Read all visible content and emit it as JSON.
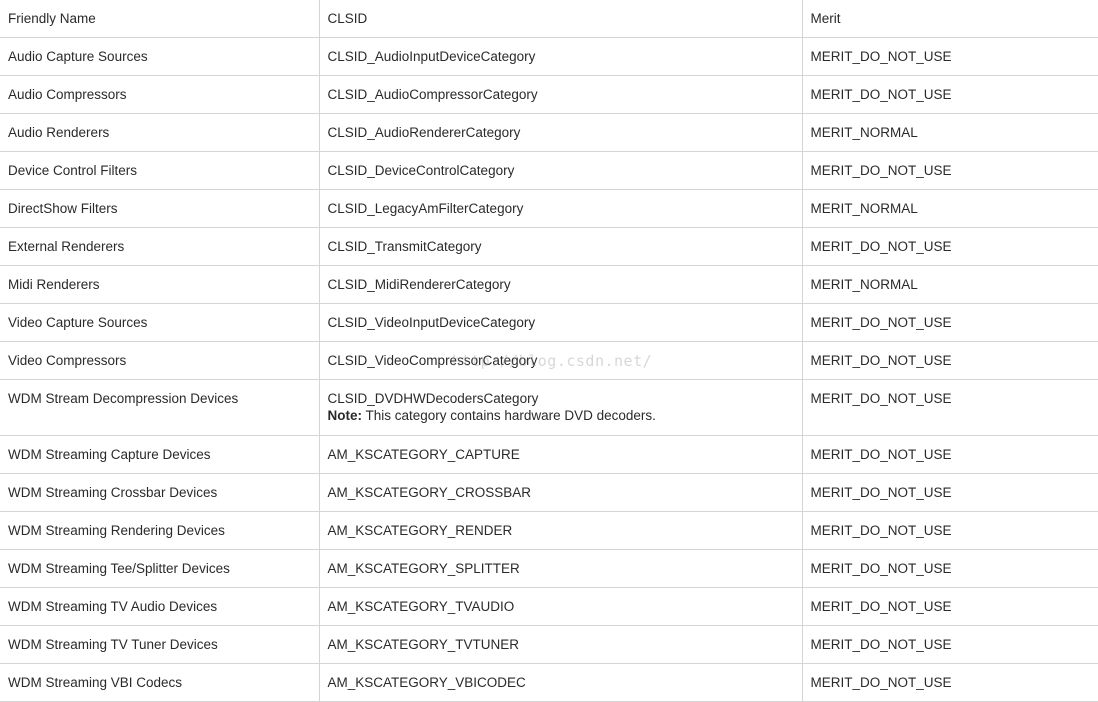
{
  "table": {
    "headers": [
      "Friendly Name",
      "CLSID",
      "Merit"
    ],
    "rows": [
      {
        "name": "Audio Capture Sources",
        "clsid": "CLSID_AudioInputDeviceCategory",
        "merit": "MERIT_DO_NOT_USE"
      },
      {
        "name": "Audio Compressors",
        "clsid": "CLSID_AudioCompressorCategory",
        "merit": "MERIT_DO_NOT_USE"
      },
      {
        "name": "Audio Renderers",
        "clsid": "CLSID_AudioRendererCategory",
        "merit": "MERIT_NORMAL"
      },
      {
        "name": "Device Control Filters",
        "clsid": "CLSID_DeviceControlCategory",
        "merit": "MERIT_DO_NOT_USE"
      },
      {
        "name": "DirectShow Filters",
        "clsid": "CLSID_LegacyAmFilterCategory",
        "merit": "MERIT_NORMAL"
      },
      {
        "name": "External Renderers",
        "clsid": "CLSID_TransmitCategory",
        "merit": "MERIT_DO_NOT_USE"
      },
      {
        "name": "Midi Renderers",
        "clsid": "CLSID_MidiRendererCategory",
        "merit": "MERIT_NORMAL"
      },
      {
        "name": "Video Capture Sources",
        "clsid": "CLSID_VideoInputDeviceCategory",
        "merit": "MERIT_DO_NOT_USE"
      },
      {
        "name": "Video Compressors",
        "clsid": "CLSID_VideoCompressorCategory",
        "merit": "MERIT_DO_NOT_USE"
      },
      {
        "name": "WDM Stream Decompression Devices",
        "clsid": "CLSID_DVDHWDecodersCategory",
        "note_label": "Note:",
        "note_text": " This category contains hardware DVD decoders.",
        "merit": "MERIT_DO_NOT_USE"
      },
      {
        "name": "WDM Streaming Capture Devices",
        "clsid": "AM_KSCATEGORY_CAPTURE",
        "merit": "MERIT_DO_NOT_USE"
      },
      {
        "name": "WDM Streaming Crossbar Devices",
        "clsid": "AM_KSCATEGORY_CROSSBAR",
        "merit": "MERIT_DO_NOT_USE"
      },
      {
        "name": "WDM Streaming Rendering Devices",
        "clsid": "AM_KSCATEGORY_RENDER",
        "merit": "MERIT_DO_NOT_USE"
      },
      {
        "name": "WDM Streaming Tee/Splitter Devices",
        "clsid": "AM_KSCATEGORY_SPLITTER",
        "merit": "MERIT_DO_NOT_USE"
      },
      {
        "name": "WDM Streaming TV Audio Devices",
        "clsid": "AM_KSCATEGORY_TVAUDIO",
        "merit": "MERIT_DO_NOT_USE"
      },
      {
        "name": "WDM Streaming TV Tuner Devices",
        "clsid": "AM_KSCATEGORY_TVTUNER",
        "merit": "MERIT_DO_NOT_USE"
      },
      {
        "name": "WDM Streaming VBI Codecs",
        "clsid": "AM_KSCATEGORY_VBICODEC",
        "merit": "MERIT_DO_NOT_USE"
      }
    ]
  },
  "watermark": "http://blog.csdn.net/"
}
